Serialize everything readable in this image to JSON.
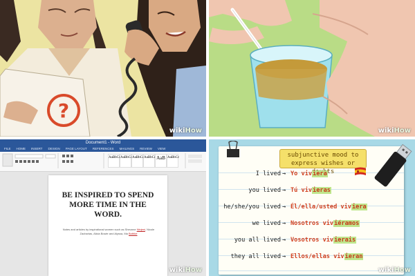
{
  "watermark": {
    "wiki": "wiki",
    "how": "How"
  },
  "word": {
    "title_bar": "Document1 - Word",
    "tabs": [
      "FILE",
      "HOME",
      "INSERT",
      "DESIGN",
      "PAGE LAYOUT",
      "REFERENCES",
      "MAILINGS",
      "REVIEW",
      "VIEW"
    ],
    "styles": [
      "AaBbCcDc",
      "AaBbCcDc",
      "AaBbCc",
      "AaBbCcDc",
      "AaB",
      "AaBbCc"
    ],
    "heading": "BE INSPIRED TO SPEND MORE TIME IN THE WORD.",
    "body_prefix": "Notes and articles by inspirational women such as Sheunne ",
    "body_link1": "Ninjeni",
    "body_middle": ", Nicole Zacharias, Alicia Bowie and Alyssa, Ma ",
    "body_link2": "Bothke"
  },
  "subjunctive": {
    "title_line1": "subjunctive mood to",
    "title_line2": "express wishes or doubts",
    "arrow": "→",
    "rows": [
      {
        "en": "I lived",
        "stem": "Yo viv",
        "ending": "iera"
      },
      {
        "en": "you lived",
        "stem": "Tú viv",
        "ending": "ieras"
      },
      {
        "en": "he/she/you lived",
        "stem": "Él/ella/usted viv",
        "ending": "iera"
      },
      {
        "en": "we lived",
        "stem": "Nosotros viv",
        "ending": "iéramos"
      },
      {
        "en": "you all lived",
        "stem": "Vosotros viv",
        "ending": "ierais"
      },
      {
        "en": "they all lived",
        "stem": "Ellos/ellas viv",
        "ending": "ieran"
      }
    ]
  },
  "colors": {
    "wiki_green": "#93b874",
    "word_blue": "#2b579a",
    "accent_orange": "#d14020",
    "highlight_green": "#bfe68c"
  }
}
